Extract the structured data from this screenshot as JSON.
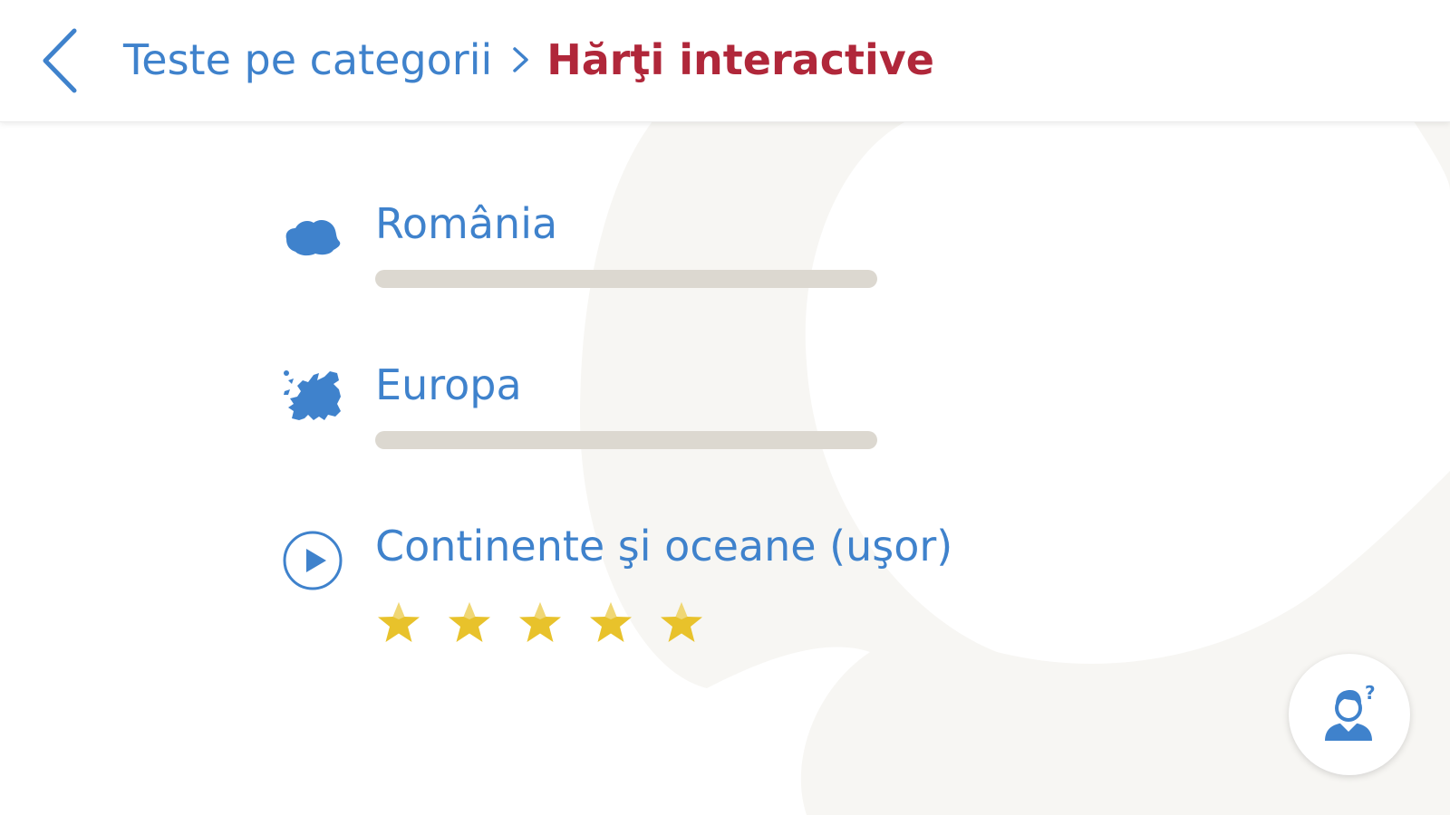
{
  "header": {
    "back_icon": "chevron-left-icon",
    "breadcrumb_parent": "Teste pe categorii",
    "breadcrumb_separator_icon": "chevron-right-icon",
    "breadcrumb_current": "Hărţi interactive"
  },
  "items": [
    {
      "icon": "romania-map-icon",
      "title": "România",
      "progress": 0
    },
    {
      "icon": "europe-map-icon",
      "title": "Europa",
      "progress": 0
    },
    {
      "icon": "play-circle-icon",
      "title": "Continente şi oceane (uşor)",
      "stars_filled": 5,
      "stars_total": 5
    }
  ],
  "help_button": {
    "icon": "help-person-icon"
  },
  "colors": {
    "accent": "#3f82cc",
    "title_red": "#b0273a",
    "progress_track": "#dcd8d0",
    "star": "#e8c22b",
    "background_shape": "#f7f6f3"
  }
}
